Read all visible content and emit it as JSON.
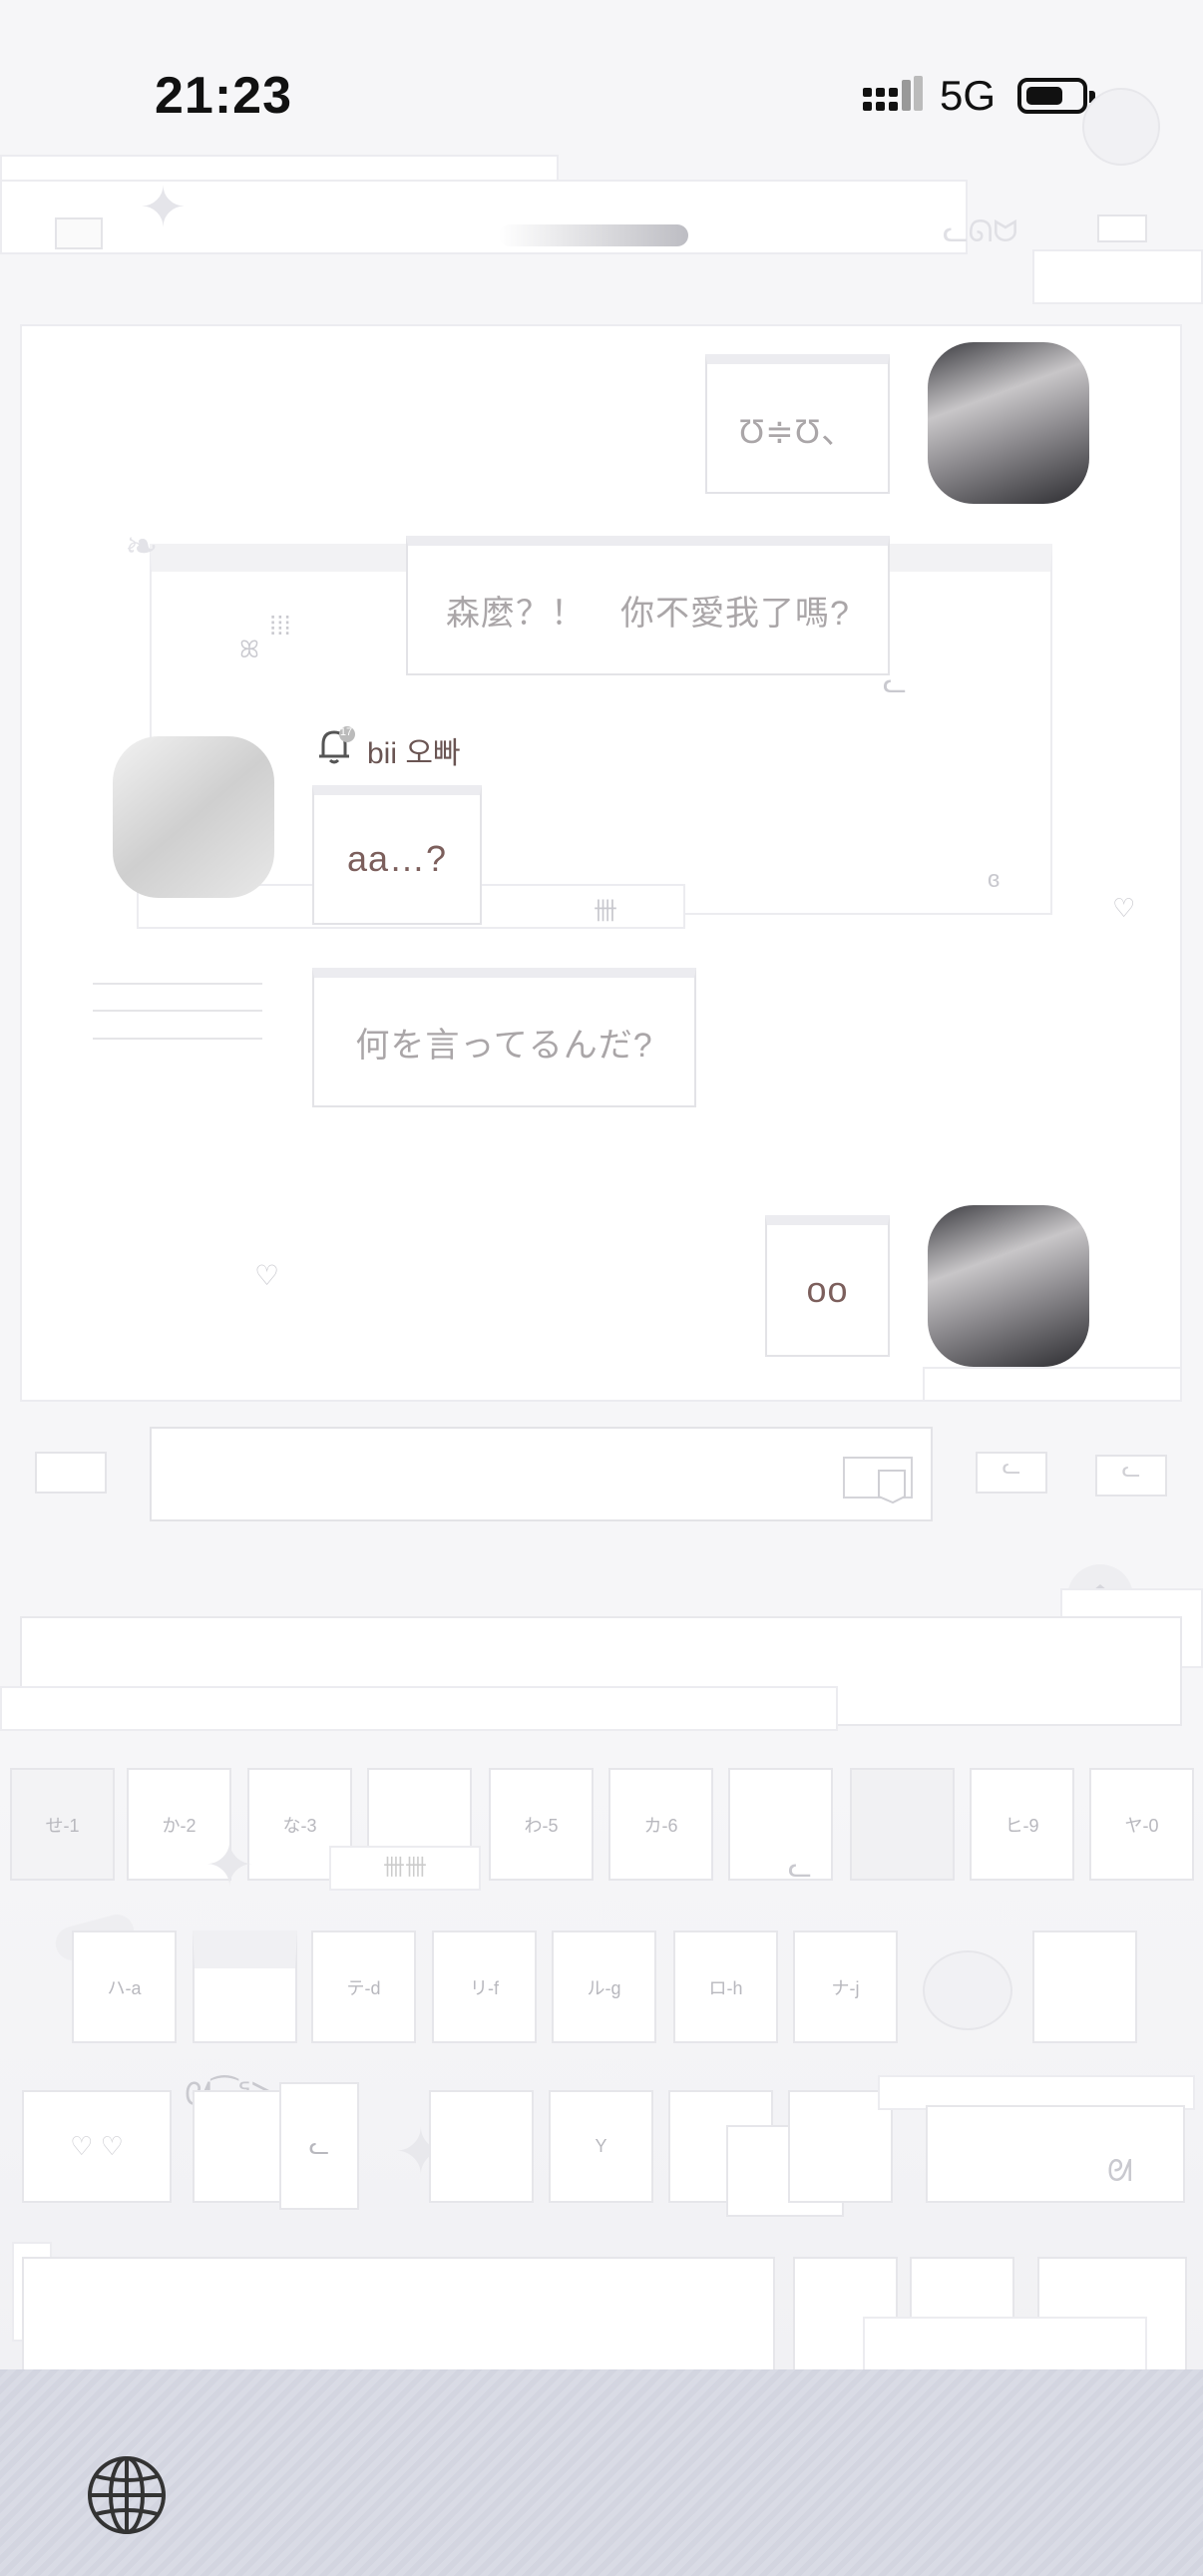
{
  "status_bar": {
    "time": "21:23",
    "network": "5G",
    "battery_level": 0.7
  },
  "chat": {
    "messages": [
      {
        "side": "right",
        "text": "Ʊ≑Ʊ、"
      },
      {
        "side": "right",
        "text": "森麼？！　你不愛我了嗎?"
      },
      {
        "side": "left",
        "text": "aa…?"
      },
      {
        "side": "left",
        "text": "何を言ってるんだ?"
      },
      {
        "side": "right",
        "text": "oo"
      }
    ],
    "sender": {
      "badge": "17",
      "name": "bii 오빠"
    }
  },
  "keyboard": {
    "row1": [
      "せ-1",
      "か-2",
      "な-3",
      "",
      "わ-5",
      "カ-6",
      "",
      "",
      "ヒ-9",
      "ヤ-0"
    ],
    "row2": [
      "ハ-a",
      "",
      "テ-d",
      "リ-f",
      "ル-g",
      "ロ-h",
      "ナ-j"
    ],
    "row3_key": "Y"
  },
  "icons": {
    "globe": "globe-icon",
    "bell": "bell-icon",
    "signal": "signal-icon",
    "battery": "battery-icon"
  },
  "colors": {
    "accent_text": "#7c5f5c",
    "muted_text": "#aaa6a8",
    "bottom_strip": "#d3d5e0"
  }
}
